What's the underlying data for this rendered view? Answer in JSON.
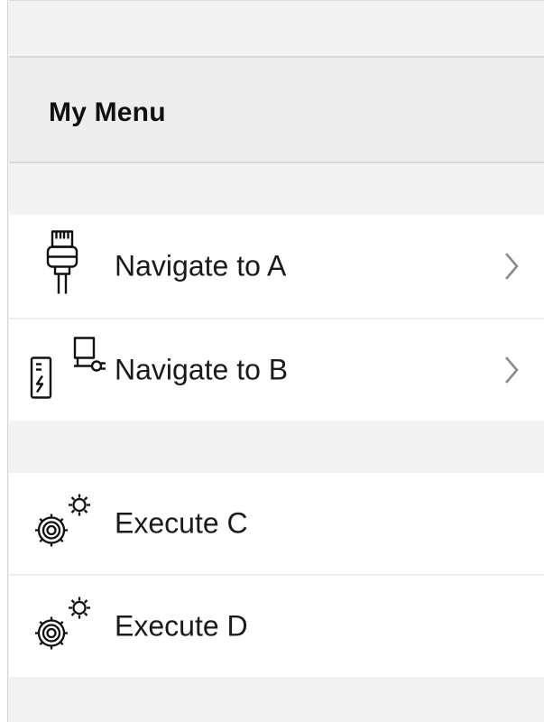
{
  "header": {
    "title": "My Menu"
  },
  "sections": [
    {
      "items": [
        {
          "label": "Navigate to A",
          "icon": "ethernet-plug-icon",
          "has_chevron": true
        },
        {
          "label": "Navigate to B",
          "icon": "network-device-icon",
          "has_chevron": true
        }
      ]
    },
    {
      "items": [
        {
          "label": "Execute C",
          "icon": "gears-icon",
          "has_chevron": false
        },
        {
          "label": "Execute D",
          "icon": "gears-icon",
          "has_chevron": false
        }
      ]
    }
  ],
  "colors": {
    "background": "#f2f2f2",
    "row_background": "#ffffff",
    "header_background": "#ededed",
    "text": "#1a1a1a",
    "chevron": "#8a8a8a",
    "icon": "#111111"
  }
}
